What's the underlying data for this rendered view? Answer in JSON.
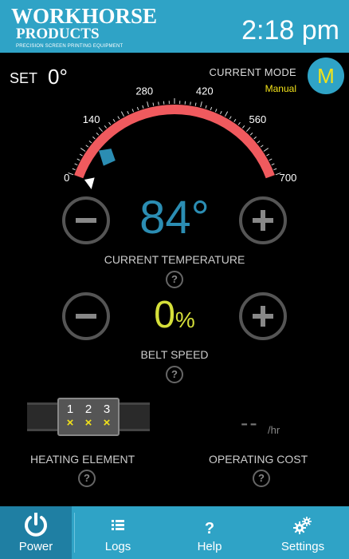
{
  "header": {
    "logo_line1": "WORKHORSE",
    "logo_line2": "PRODUCTS",
    "logo_tagline": "PRECISION SCREEN PRINTING EQUIPMENT",
    "clock": "2:18 pm"
  },
  "setpoint": {
    "label": "SET",
    "value": "0°"
  },
  "mode": {
    "label": "CURRENT MODE",
    "value": "Manual",
    "badge": "M"
  },
  "gauge": {
    "ticks": [
      "0",
      "140",
      "280",
      "420",
      "560",
      "700"
    ],
    "min": 0,
    "max": 700,
    "set_value": 0,
    "current_value": 84
  },
  "temperature": {
    "value": "84°",
    "label": "CURRENT TEMPERATURE"
  },
  "belt": {
    "value": "0",
    "unit": "%",
    "label": "BELT SPEED"
  },
  "heating": {
    "label": "HEATING ELEMENT",
    "zones": [
      {
        "num": "1",
        "state": "×"
      },
      {
        "num": "2",
        "state": "×"
      },
      {
        "num": "3",
        "state": "×"
      }
    ]
  },
  "cost": {
    "value": "--",
    "unit": "/hr",
    "label": "OPERATING COST"
  },
  "help_glyph": "?",
  "nav": [
    {
      "label": "Power",
      "icon": "power-icon"
    },
    {
      "label": "Logs",
      "icon": "list-icon"
    },
    {
      "label": "Help",
      "icon": "question-icon"
    },
    {
      "label": "Settings",
      "icon": "gears-icon"
    }
  ],
  "colors": {
    "brand": "#2fa3c6",
    "temp": "#2b8db3",
    "belt": "#d6e03a",
    "accent": "#f2e21a",
    "arc": "#f05a5e"
  }
}
